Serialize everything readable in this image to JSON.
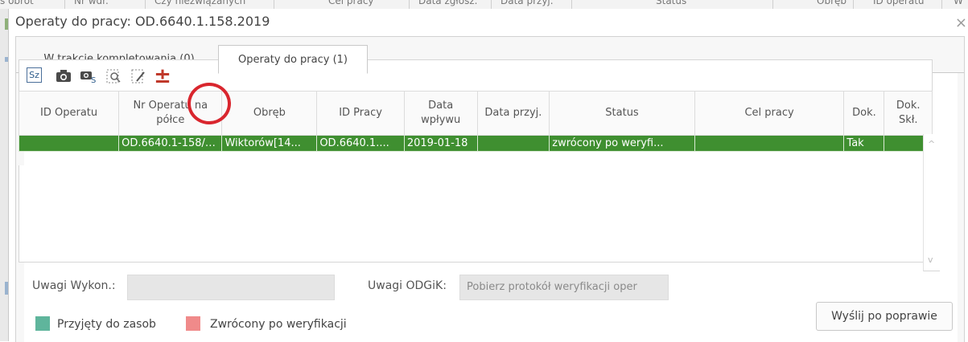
{
  "background_header": {
    "columns": [
      "s obrót",
      "Nr wdr.",
      "Czy niezwiązanych",
      "Cel pracy",
      "Data zgłosz.",
      "Data przyj.",
      "Status",
      "Obręb",
      "ID operatu",
      "W"
    ]
  },
  "dialog": {
    "title": "Operaty do pracy: OD.6640.1.158.2019",
    "close_label": "×"
  },
  "tabs": [
    {
      "label": "W trakcie kompletowania (0)",
      "active": false
    },
    {
      "label": "Operaty do pracy (1)",
      "active": true
    }
  ],
  "toolbar": {
    "sz_label": "Sz",
    "icons": [
      "camera-icon",
      "camera-settings-icon",
      "preview-icon",
      "edit-icon",
      "plus-minus-icon"
    ],
    "plus_minus": "±",
    "highlight_color": "#d9262e"
  },
  "table": {
    "headers": [
      "ID Operatu",
      "Nr Operatu na półce",
      "Obręb",
      "ID Pracy",
      "Data wpływu",
      "Data przyj.",
      "Status",
      "Cel pracy",
      "Dok.",
      "Dok. Skł."
    ],
    "rows": [
      [
        "",
        "OD.6640.1-158/2...",
        "Wiktorów[14...",
        "OD.6640.1....",
        "2019-01-18",
        "",
        "zwrócony po weryfi...",
        "",
        "Tak",
        ""
      ]
    ],
    "selected_row_color": "#3f8f30"
  },
  "form": {
    "uwagi_wykon_label": "Uwagi Wykon.:",
    "uwagi_wykon_value": "",
    "uwagi_odgik_label": "Uwagi ODGiK:",
    "uwagi_odgik_value": "Pobierz protokół weryfikacji oper"
  },
  "legend": [
    {
      "label": "Przyjęty do zasob",
      "color": "#5fb59c"
    },
    {
      "label": "Zwrócony po weryfikacji",
      "color": "#f08a8a"
    }
  ],
  "send_button_label": "Wyślij po poprawie",
  "scroll": {
    "up": "^",
    "down": "v"
  }
}
